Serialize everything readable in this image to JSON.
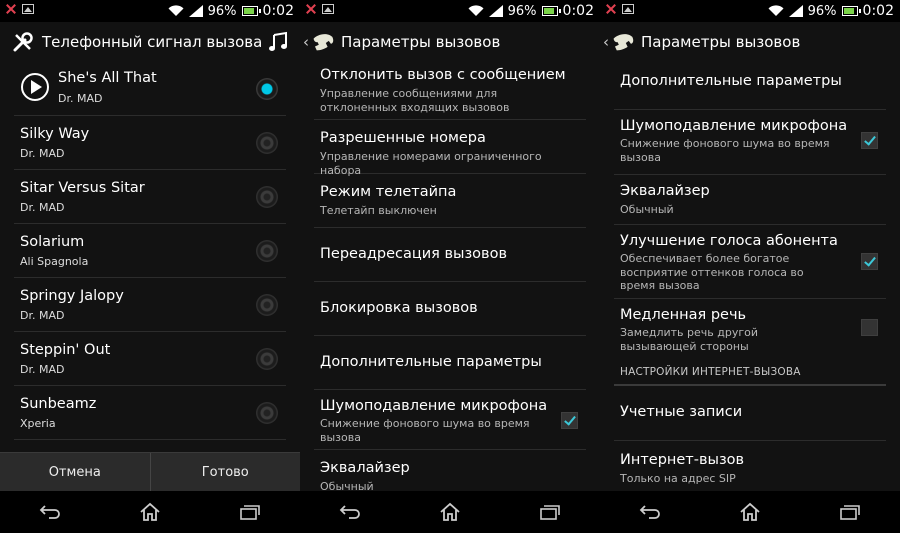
{
  "statusbar": {
    "battery": "96%",
    "time": "0:02"
  },
  "screen1": {
    "title": "Телефонный сигнал вызова",
    "ringtones": [
      {
        "name": "She's All That",
        "artist": "Dr. MAD",
        "selected": true
      },
      {
        "name": "Silky Way",
        "artist": "Dr. MAD",
        "selected": false
      },
      {
        "name": "Sitar Versus Sitar",
        "artist": "Dr. MAD",
        "selected": false
      },
      {
        "name": "Solarium",
        "artist": "Ali Spagnola",
        "selected": false
      },
      {
        "name": "Springy Jalopy",
        "artist": "Dr. MAD",
        "selected": false
      },
      {
        "name": "Steppin' Out",
        "artist": "Dr. MAD",
        "selected": false
      },
      {
        "name": "Sunbeamz",
        "artist": "Xperia",
        "selected": false
      }
    ],
    "cancel_label": "Отмена",
    "done_label": "Готово"
  },
  "screen2": {
    "title": "Параметры вызовов",
    "items": [
      {
        "title": "Отклонить вызов с сообщением",
        "summary": "Управление сообщениями для отклоненных входящих вызовов"
      },
      {
        "title": "Разрешенные номера",
        "summary": "Управление номерами ограниченного набора"
      },
      {
        "title": "Режим телетайпа",
        "summary": "Телетайп выключен"
      },
      {
        "title": "Переадресация вызовов",
        "summary": ""
      },
      {
        "title": "Блокировка вызовов",
        "summary": ""
      },
      {
        "title": "Дополнительные параметры",
        "summary": ""
      },
      {
        "title": "Шумоподавление микрофона",
        "summary": "Снижение фонового шума во время вызова",
        "checked": true
      },
      {
        "title": "Эквалайзер",
        "summary": "Обычный"
      }
    ]
  },
  "screen3": {
    "title": "Параметры вызовов",
    "items": [
      {
        "title": "Дополнительные параметры",
        "summary": ""
      },
      {
        "title": "Шумоподавление микрофона",
        "summary": "Снижение фонового шума во время вызова",
        "checked": true
      },
      {
        "title": "Эквалайзер",
        "summary": "Обычный"
      },
      {
        "title": "Улучшение голоса абонента",
        "summary": "Обеспечивает более богатое восприятие оттенков голоса во время вызова",
        "checked": true
      },
      {
        "title": "Медленная речь",
        "summary": "Замедлить речь другой вызывающей стороны",
        "checked": false
      }
    ],
    "section_header": "НАСТРОЙКИ ИНТЕРНЕТ-ВЫЗОВА",
    "internet_items": [
      {
        "title": "Учетные записи",
        "summary": ""
      },
      {
        "title": "Интернет-вызов",
        "summary": "Только на адрес SIP"
      }
    ]
  },
  "colors": {
    "accent": "#00c8e6",
    "check": "#3cc8d8",
    "background": "#121212",
    "divider": "#2c2c2c"
  }
}
